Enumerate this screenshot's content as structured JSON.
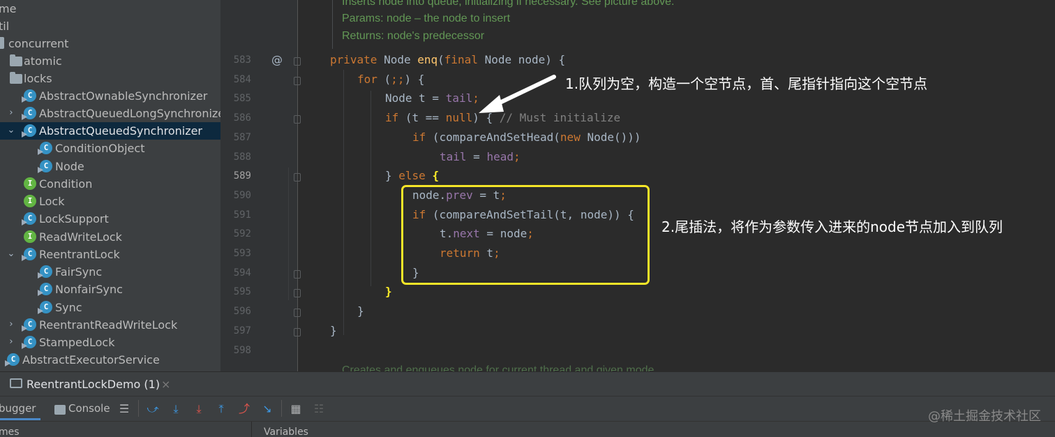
{
  "project_tree": {
    "items": [
      {
        "label": "me",
        "icon": "none"
      },
      {
        "label": "til",
        "icon": "none"
      },
      {
        "label": "concurrent",
        "icon": "package-icon"
      },
      {
        "label": "atomic",
        "icon": "folder-icon"
      },
      {
        "label": "locks",
        "icon": "folder-icon"
      },
      {
        "label": "AbstractOwnableSynchronizer",
        "icon": "class-icon"
      },
      {
        "label": "AbstractQueuedLongSynchronizer",
        "icon": "class-icon",
        "chevron": ">"
      },
      {
        "label": "AbstractQueuedSynchronizer",
        "icon": "class-icon",
        "chevron": "v",
        "selected": true
      },
      {
        "label": "ConditionObject",
        "icon": "class-icon"
      },
      {
        "label": "Node",
        "icon": "class-icon"
      },
      {
        "label": "Condition",
        "icon": "interface-icon"
      },
      {
        "label": "Lock",
        "icon": "interface-icon"
      },
      {
        "label": "LockSupport",
        "icon": "class-icon"
      },
      {
        "label": "ReadWriteLock",
        "icon": "interface-icon"
      },
      {
        "label": "ReentrantLock",
        "icon": "class-icon",
        "chevron": "v"
      },
      {
        "label": "FairSync",
        "icon": "class-icon"
      },
      {
        "label": "NonfairSync",
        "icon": "class-icon"
      },
      {
        "label": "Sync",
        "icon": "class-icon"
      },
      {
        "label": "ReentrantReadWriteLock",
        "icon": "class-icon",
        "chevron": ">"
      },
      {
        "label": "StampedLock",
        "icon": "class-icon",
        "chevron": ">"
      },
      {
        "label": "AbstractExecutorService",
        "icon": "class-icon"
      }
    ]
  },
  "editor": {
    "doc_lines": [
      "Inserts node into queue, initializing if necessary. See picture above.",
      "Params:  node – the node to insert",
      "Returns: node's predecessor"
    ],
    "code_lines": [
      {
        "num": "583",
        "text": "private Node enq(final Node node) {"
      },
      {
        "num": "584",
        "text": "for (;;) {"
      },
      {
        "num": "585",
        "text": "Node t = tail;"
      },
      {
        "num": "586",
        "text": "if (t == null) { // Must initialize"
      },
      {
        "num": "587",
        "text": "if (compareAndSetHead(new Node()))"
      },
      {
        "num": "588",
        "text": "tail = head;"
      },
      {
        "num": "589",
        "text": "} else {"
      },
      {
        "num": "590",
        "text": "node.prev = t;"
      },
      {
        "num": "591",
        "text": "if (compareAndSetTail(t, node)) {"
      },
      {
        "num": "592",
        "text": "t.next = node;"
      },
      {
        "num": "593",
        "text": "return t;"
      },
      {
        "num": "594",
        "text": "}"
      },
      {
        "num": "595",
        "text": "}"
      },
      {
        "num": "596",
        "text": "}"
      },
      {
        "num": "597",
        "text": "}"
      },
      {
        "num": "598",
        "text": ""
      }
    ],
    "trailing_doc": "Creates and enqueues node for current thread and given mode.",
    "annotation_1": "1.队列为空，构造一个空节点，首、尾指针指向这个空节点",
    "annotation_2": "2.尾插法，将作为参数传入进来的node节点加入到队列"
  },
  "bottom_panel": {
    "run_tab": "ReentrantLockDemo (1)",
    "debugger_tab": "bugger",
    "console_tab": "Console",
    "frames_label": "mes",
    "variables_label": "Variables"
  },
  "watermark": "@稀土掘金技术社区",
  "colors": {
    "highlight_box": "#f5e528",
    "keyword": "#cc7832",
    "method": "#ffc66d",
    "field": "#9876aa",
    "doc": "#629755"
  }
}
